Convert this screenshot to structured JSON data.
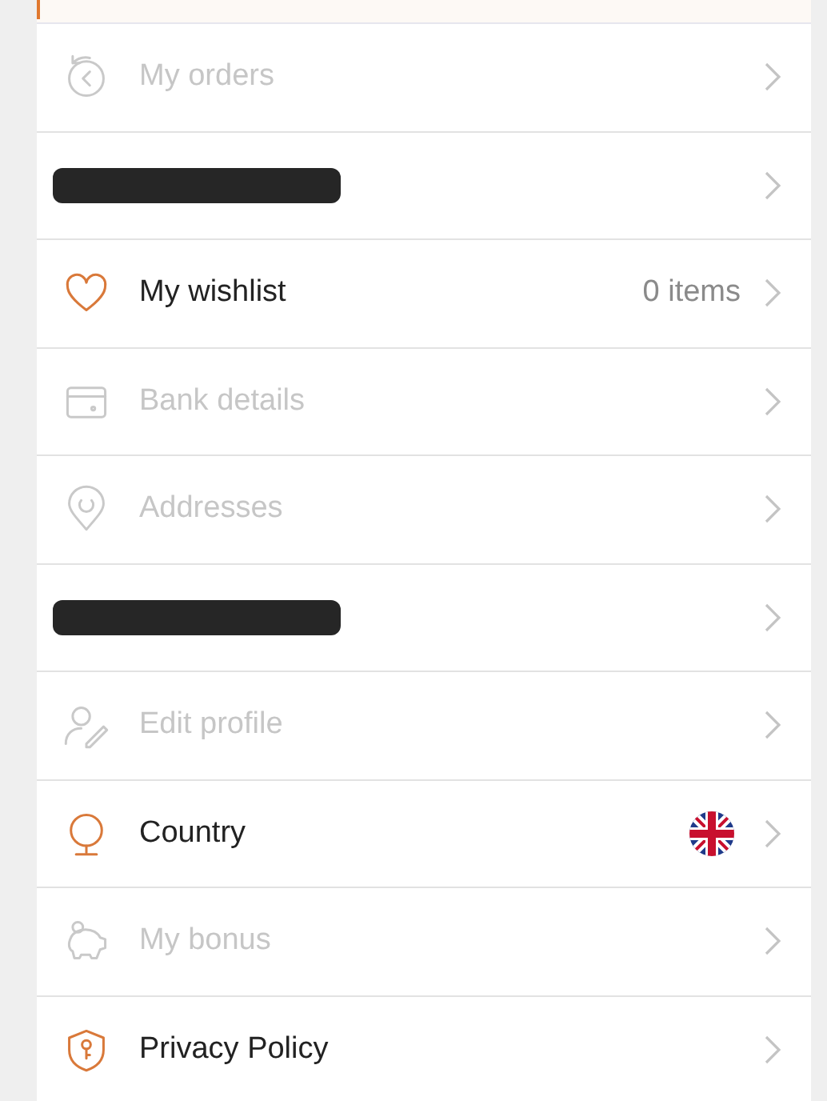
{
  "menu_items": [
    {
      "kind": "link",
      "label": "My orders",
      "disabled": true
    },
    {
      "kind": "redacted"
    },
    {
      "kind": "count",
      "label": "My wishlist",
      "value": "0 items",
      "disabled": false
    },
    {
      "kind": "link",
      "label": "Bank details",
      "disabled": true
    },
    {
      "kind": "link",
      "label": "Addresses",
      "disabled": true
    },
    {
      "kind": "redacted"
    },
    {
      "kind": "link",
      "label": "Edit profile",
      "disabled": true
    },
    {
      "kind": "flag",
      "label": "Country",
      "disabled": false
    },
    {
      "kind": "link",
      "label": "My bonus",
      "disabled": true
    },
    {
      "kind": "link",
      "label": "Privacy Policy",
      "disabled": false
    }
  ]
}
